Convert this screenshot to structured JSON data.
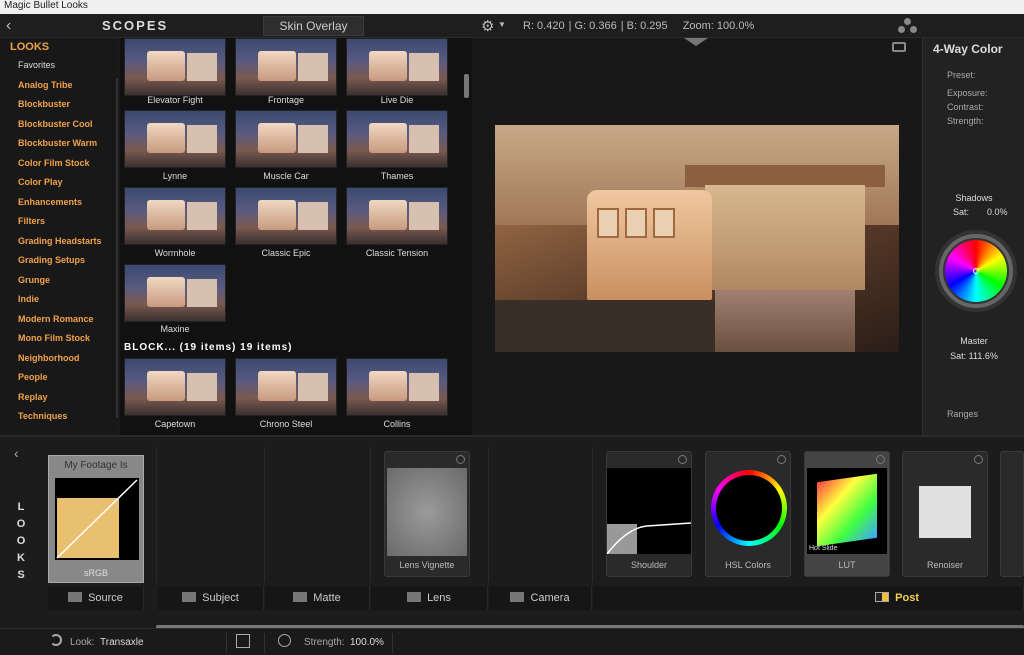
{
  "window": {
    "title": "Magic Bullet Looks"
  },
  "toolbar": {
    "back": "‹",
    "scopes_title": "SCOPES",
    "skin_tab": "Skin Overlay",
    "gear": "⚙",
    "caret": "▼",
    "r": "R: 0.420",
    "g": "G: 0.366",
    "b": "B: 0.295",
    "zoom": "Zoom: 100.0%"
  },
  "looks_panel": {
    "title": "LOOKS",
    "categories": [
      {
        "label": "Favorites"
      },
      {
        "label": "Analog Tribe"
      },
      {
        "label": "Blockbuster"
      },
      {
        "label": "Blockbuster Cool"
      },
      {
        "label": "Blockbuster Warm"
      },
      {
        "label": "Color Film Stock"
      },
      {
        "label": "Color Play"
      },
      {
        "label": "Enhancements"
      },
      {
        "label": "Filters"
      },
      {
        "label": "Grading Headstarts"
      },
      {
        "label": "Grading Setups"
      },
      {
        "label": "Grunge"
      },
      {
        "label": "Indie"
      },
      {
        "label": "Modern Romance"
      },
      {
        "label": "Mono Film Stock"
      },
      {
        "label": "Neighborhood"
      },
      {
        "label": "People"
      },
      {
        "label": "Replay"
      },
      {
        "label": "Techniques"
      }
    ]
  },
  "presets": {
    "items": [
      "Elevator Fight",
      "Frontage",
      "Live Die",
      "Lynne",
      "Muscle Car",
      "Thames",
      "Wormhole",
      "Classic Epic",
      "Classic Tension",
      "Maxine"
    ],
    "section_title": "BLOCK... (19 items)  19 items)",
    "section_items": [
      "Capetown",
      "Chrono Steel",
      "Collins"
    ]
  },
  "right_panel": {
    "title": "4-Way Color",
    "preset": "Preset:",
    "exposure": "Exposure:",
    "contrast": "Contrast:",
    "strength": "Strength:",
    "shadows": "Shadows",
    "shadows_sat_label": "Sat:",
    "shadows_sat_value": "0.0%",
    "master": "Master",
    "master_sat": "Sat:  111.6%",
    "ranges": "Ranges"
  },
  "pipeline": {
    "back": "‹",
    "looks_letters": [
      "L",
      "O",
      "O",
      "K",
      "S"
    ],
    "footage_title": "My Footage Is",
    "footage_sub": "sRGB",
    "cards": [
      {
        "label": "Lens Vignette"
      },
      {
        "label": "Shoulder"
      },
      {
        "label": "HSL Colors"
      },
      {
        "label": "LUT",
        "badge": "Hot Slide"
      },
      {
        "label": "Renoiser"
      }
    ],
    "tabs": [
      "Source",
      "Subject",
      "Matte",
      "Lens",
      "Camera",
      "Post"
    ]
  },
  "status": {
    "look_label": "Look:",
    "look_value": "Transaxle",
    "strength_label": "Strength:",
    "strength_value": "100.0%"
  }
}
